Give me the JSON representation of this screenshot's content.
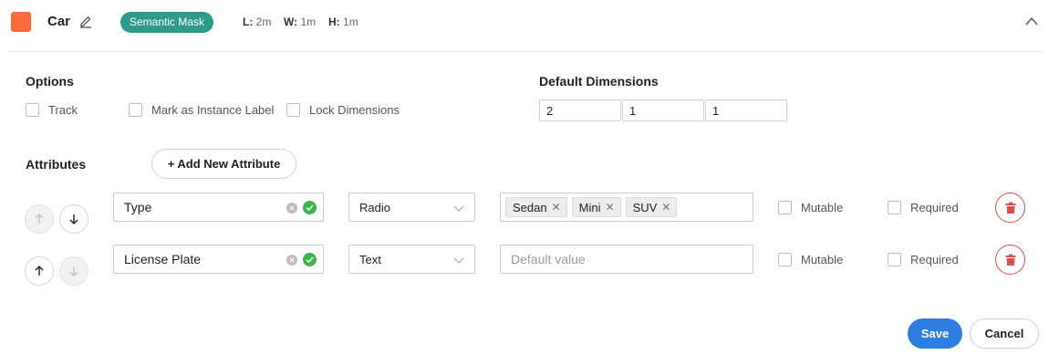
{
  "header": {
    "class_name": "Car",
    "class_color": "#ff6a3d",
    "annotation_type": "Semantic Mask",
    "badge_color": "#2e9a8a",
    "dims": [
      {
        "key": "L:",
        "value": "2m"
      },
      {
        "key": "W:",
        "value": "1m"
      },
      {
        "key": "H:",
        "value": "1m"
      }
    ],
    "collapse_icon": "chevron-up-icon",
    "edit_icon": "pencil-icon"
  },
  "options": {
    "title": "Options",
    "items": [
      {
        "label": "Track",
        "checked": false
      },
      {
        "label": "Mark as Instance Label",
        "checked": false
      },
      {
        "label": "Lock Dimensions",
        "checked": false
      }
    ]
  },
  "default_dimensions": {
    "title": "Default Dimensions",
    "values": [
      "2",
      "1",
      "1"
    ]
  },
  "attributes": {
    "title": "Attributes",
    "add_button": "+ Add New Attribute",
    "rows": [
      {
        "name": "Type",
        "input_type": "Radio",
        "values": [
          "Sedan",
          "Mini",
          "SUV"
        ],
        "placeholder": "",
        "up_enabled": false,
        "down_enabled": true,
        "mutable_label": "Mutable",
        "required_label": "Required"
      },
      {
        "name": "License Plate",
        "input_type": "Text",
        "values": [],
        "placeholder": "Default value",
        "up_enabled": true,
        "down_enabled": false,
        "mutable_label": "Mutable",
        "required_label": "Required"
      }
    ]
  },
  "footer": {
    "save_label": "Save",
    "cancel_label": "Cancel"
  },
  "colors": {
    "accent": "#2e7de1",
    "danger": "#e24c4c",
    "valid": "#3bb54a"
  }
}
